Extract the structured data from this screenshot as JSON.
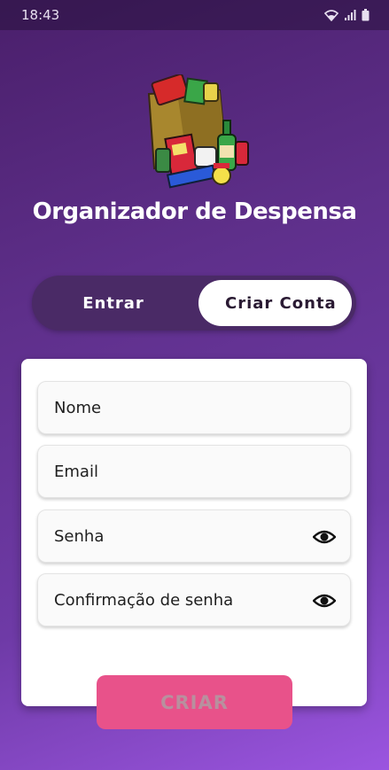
{
  "status_bar": {
    "time": "18:43"
  },
  "app": {
    "title": "Organizador de Despensa"
  },
  "auth_tabs": {
    "login_label": "Entrar",
    "signup_label": "Criar Conta"
  },
  "form": {
    "name_placeholder": "Nome",
    "email_placeholder": "Email",
    "password_placeholder": "Senha",
    "confirm_placeholder": "Confirmação de senha"
  },
  "actions": {
    "create_label": "CRIAR"
  },
  "colors": {
    "accent": "#e8528a",
    "tab_track": "#4a2a66",
    "background_top": "#4a1f6b",
    "background_bottom": "#9b55e0"
  },
  "icons": {
    "logo": "grocery-bag-icon",
    "password_toggle": "eye-icon",
    "status": [
      "wifi-icon",
      "signal-icon",
      "battery-icon"
    ]
  }
}
